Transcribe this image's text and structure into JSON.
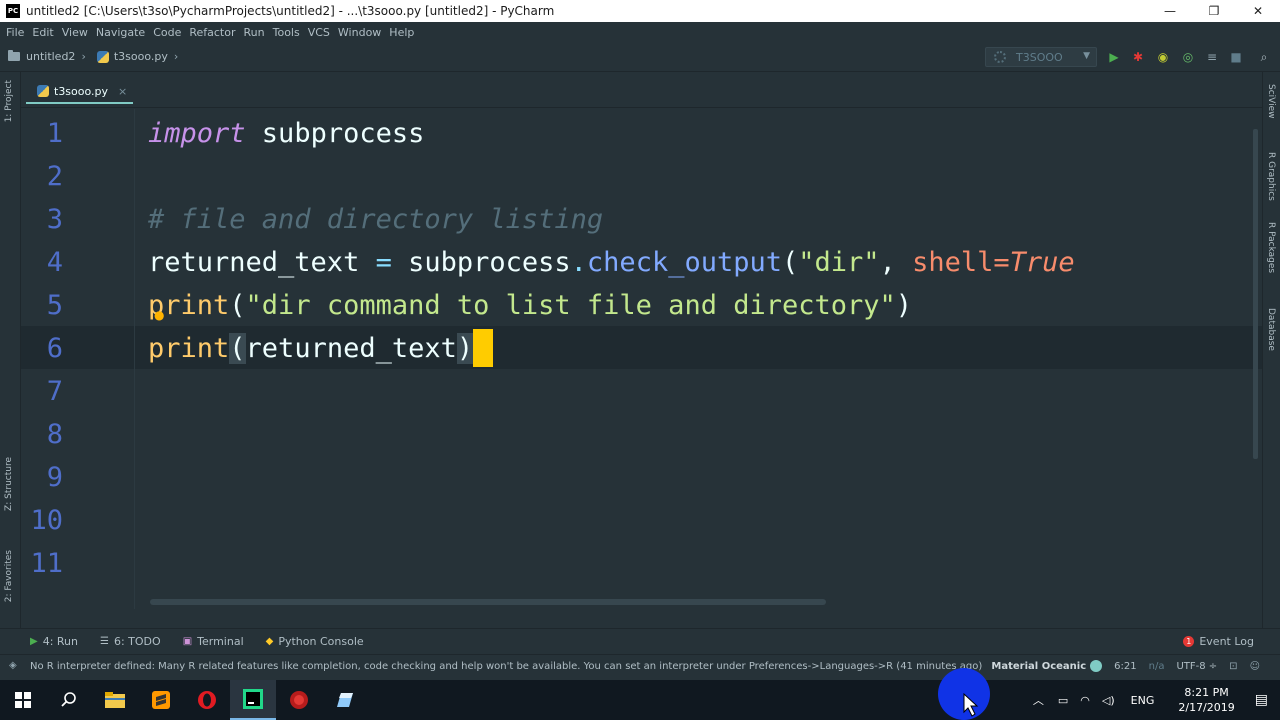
{
  "window": {
    "title": "untitled2 [C:\\Users\\t3so\\PycharmProjects\\untitled2] - ...\\t3sooo.py [untitled2] - PyCharm",
    "minimize": "—",
    "maximize": "❐",
    "close": "✕"
  },
  "menu": [
    "File",
    "Edit",
    "View",
    "Navigate",
    "Code",
    "Refactor",
    "Run",
    "Tools",
    "VCS",
    "Window",
    "Help"
  ],
  "nav": {
    "project": "untitled2",
    "file": "t3sooo.py",
    "run_config": "T3SOOO"
  },
  "left_tools": {
    "project": "1: Project",
    "structure": "Z: Structure",
    "favorites": "2: Favorites"
  },
  "right_tools": {
    "sciview": "SciView",
    "r_graphics": "R Graphics",
    "r_packages": "R Packages",
    "database": "Database"
  },
  "tab": {
    "label": "t3sooo.py",
    "close": "×"
  },
  "editor": {
    "line_numbers": [
      "1",
      "2",
      "3",
      "4",
      "5",
      "6",
      "7",
      "8",
      "9",
      "10",
      "11"
    ],
    "code": {
      "l1_kw": "import",
      "l1_mod": " subprocess",
      "l3_comment": "# file and directory listing",
      "l4_var": "returned_text ",
      "l4_eq": "=",
      "l4_mod": " subprocess",
      "l4_dot": ".",
      "l4_fn": "check_output",
      "l4_open": "(",
      "l4_str": "\"dir\"",
      "l4_comma": ", ",
      "l4_param": "shell",
      "l4_eq2": "=",
      "l4_val": "True",
      "l5_fn": "print",
      "l5_open": "(",
      "l5_str": "\"dir command to list file and directory\"",
      "l5_close": ")",
      "l6_fn": "print",
      "l6_open": "(",
      "l6_arg": "returned_text",
      "l6_close": ")"
    }
  },
  "bottom_tools": [
    {
      "icon": "▶",
      "label": "4: Run"
    },
    {
      "icon": "☰",
      "label": "6: TODO"
    },
    {
      "icon": "▣",
      "label": "Terminal"
    },
    {
      "icon": "◆",
      "label": "Python Console"
    }
  ],
  "event_log": {
    "count": "1",
    "label": "Event Log"
  },
  "status": {
    "message": "No R interpreter defined: Many R related features like completion, code checking and help won't be available. You can set an interpreter under Preferences->Languages->R (41 minutes ago)",
    "theme": "Material Oceanic",
    "position": "6:21",
    "na": "n/a",
    "encoding": "UTF-8 ÷"
  },
  "taskbar": {
    "lang": "ENG",
    "time": "8:21 PM",
    "date": "2/17/2019"
  },
  "colors": {
    "background": "#263238",
    "keyword": "#c792ea",
    "comment": "#546e7a",
    "function": "#82aaff",
    "string": "#c3e88d",
    "param": "#f78c6c",
    "caret": "#ffcc00",
    "line_number": "#4f6ec9"
  }
}
